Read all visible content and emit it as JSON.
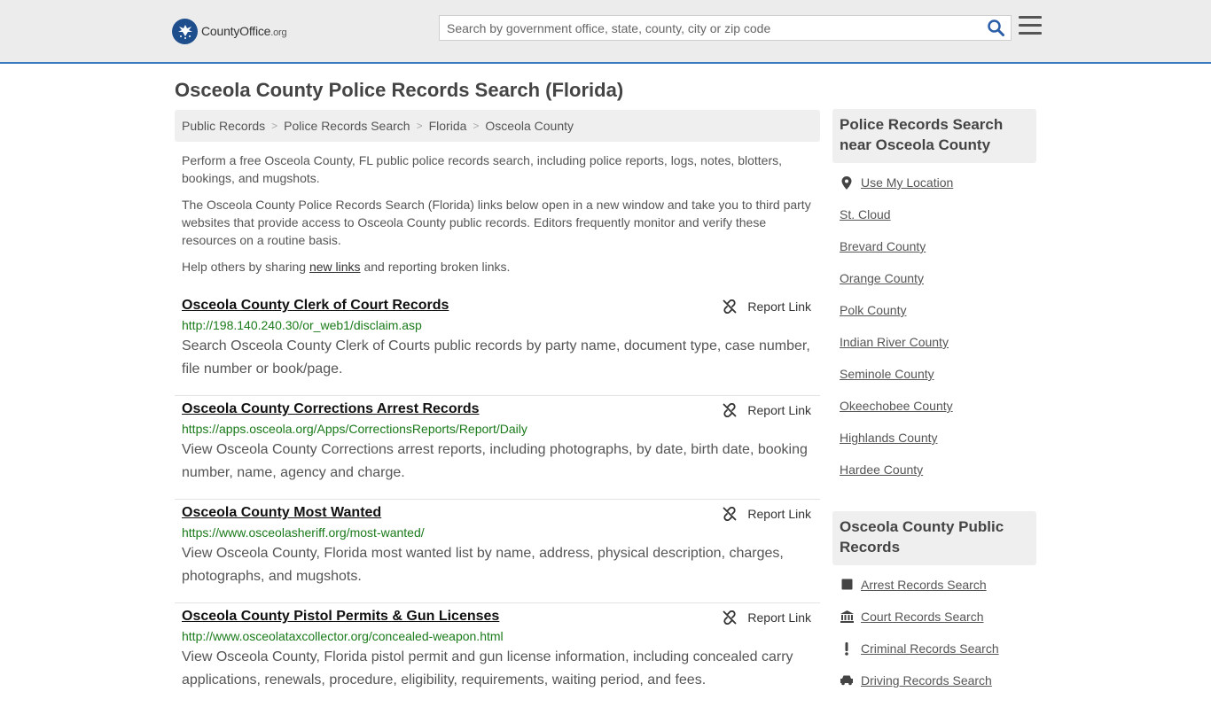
{
  "header": {
    "logo_text": "CountyOffice",
    "logo_suffix": ".org",
    "search_placeholder": "Search by government office, state, county, city or zip code"
  },
  "page_title": "Osceola County Police Records Search (Florida)",
  "breadcrumb": [
    "Public Records",
    "Police Records Search",
    "Florida",
    "Osceola County"
  ],
  "intro": {
    "p1": "Perform a free Osceola County, FL public police records search, including police reports, logs, notes, blotters, bookings, and mugshots.",
    "p2": "The Osceola County Police Records Search (Florida) links below open in a new window and take you to third party websites that provide access to Osceola County public records. Editors frequently monitor and verify these resources on a routine basis.",
    "p3_before": "Help others by sharing ",
    "p3_link": "new links",
    "p3_after": " and reporting broken links."
  },
  "report_label": "Report Link",
  "results": [
    {
      "title": "Osceola County Clerk of Court Records",
      "url": "http://198.140.240.30/or_web1/disclaim.asp",
      "desc": "Search Osceola County Clerk of Courts public records by party name, document type, case number, file number or book/page."
    },
    {
      "title": "Osceola County Corrections Arrest Records",
      "url": "https://apps.osceola.org/Apps/CorrectionsReports/Report/Daily",
      "desc": "View Osceola County Corrections arrest reports, including photographs, by date, birth date, booking number, name, agency and charge."
    },
    {
      "title": "Osceola County Most Wanted",
      "url": "https://www.osceolasheriff.org/most-wanted/",
      "desc": "View Osceola County, Florida most wanted list by name, address, physical description, charges, photographs, and mugshots."
    },
    {
      "title": "Osceola County Pistol Permits & Gun Licenses",
      "url": "http://www.osceolataxcollector.org/concealed-weapon.html",
      "desc": "View Osceola County, Florida pistol permit and gun license information, including concealed carry applications, renewals, procedure, eligibility, requirements, waiting period, and fees."
    }
  ],
  "sidebar": {
    "near_title": "Police Records Search near Osceola County",
    "near_items": [
      {
        "label": "Use My Location",
        "icon": "location-pin-icon"
      },
      {
        "label": "St. Cloud"
      },
      {
        "label": "Brevard County"
      },
      {
        "label": "Orange County"
      },
      {
        "label": "Polk County"
      },
      {
        "label": "Indian River County"
      },
      {
        "label": "Seminole County"
      },
      {
        "label": "Okeechobee County"
      },
      {
        "label": "Highlands County"
      },
      {
        "label": "Hardee County"
      }
    ],
    "public_title": "Osceola County Public Records",
    "public_items": [
      {
        "label": "Arrest Records Search",
        "icon": "square-icon"
      },
      {
        "label": "Court Records Search",
        "icon": "courthouse-icon"
      },
      {
        "label": "Criminal Records Search",
        "icon": "exclamation-icon"
      },
      {
        "label": "Driving Records Search",
        "icon": "car-icon"
      }
    ]
  },
  "colors": {
    "header_bg": "#ececec",
    "header_border": "#3a7bbf",
    "url_green": "#1a7a1a",
    "logo_blue": "#1f4e8c"
  }
}
